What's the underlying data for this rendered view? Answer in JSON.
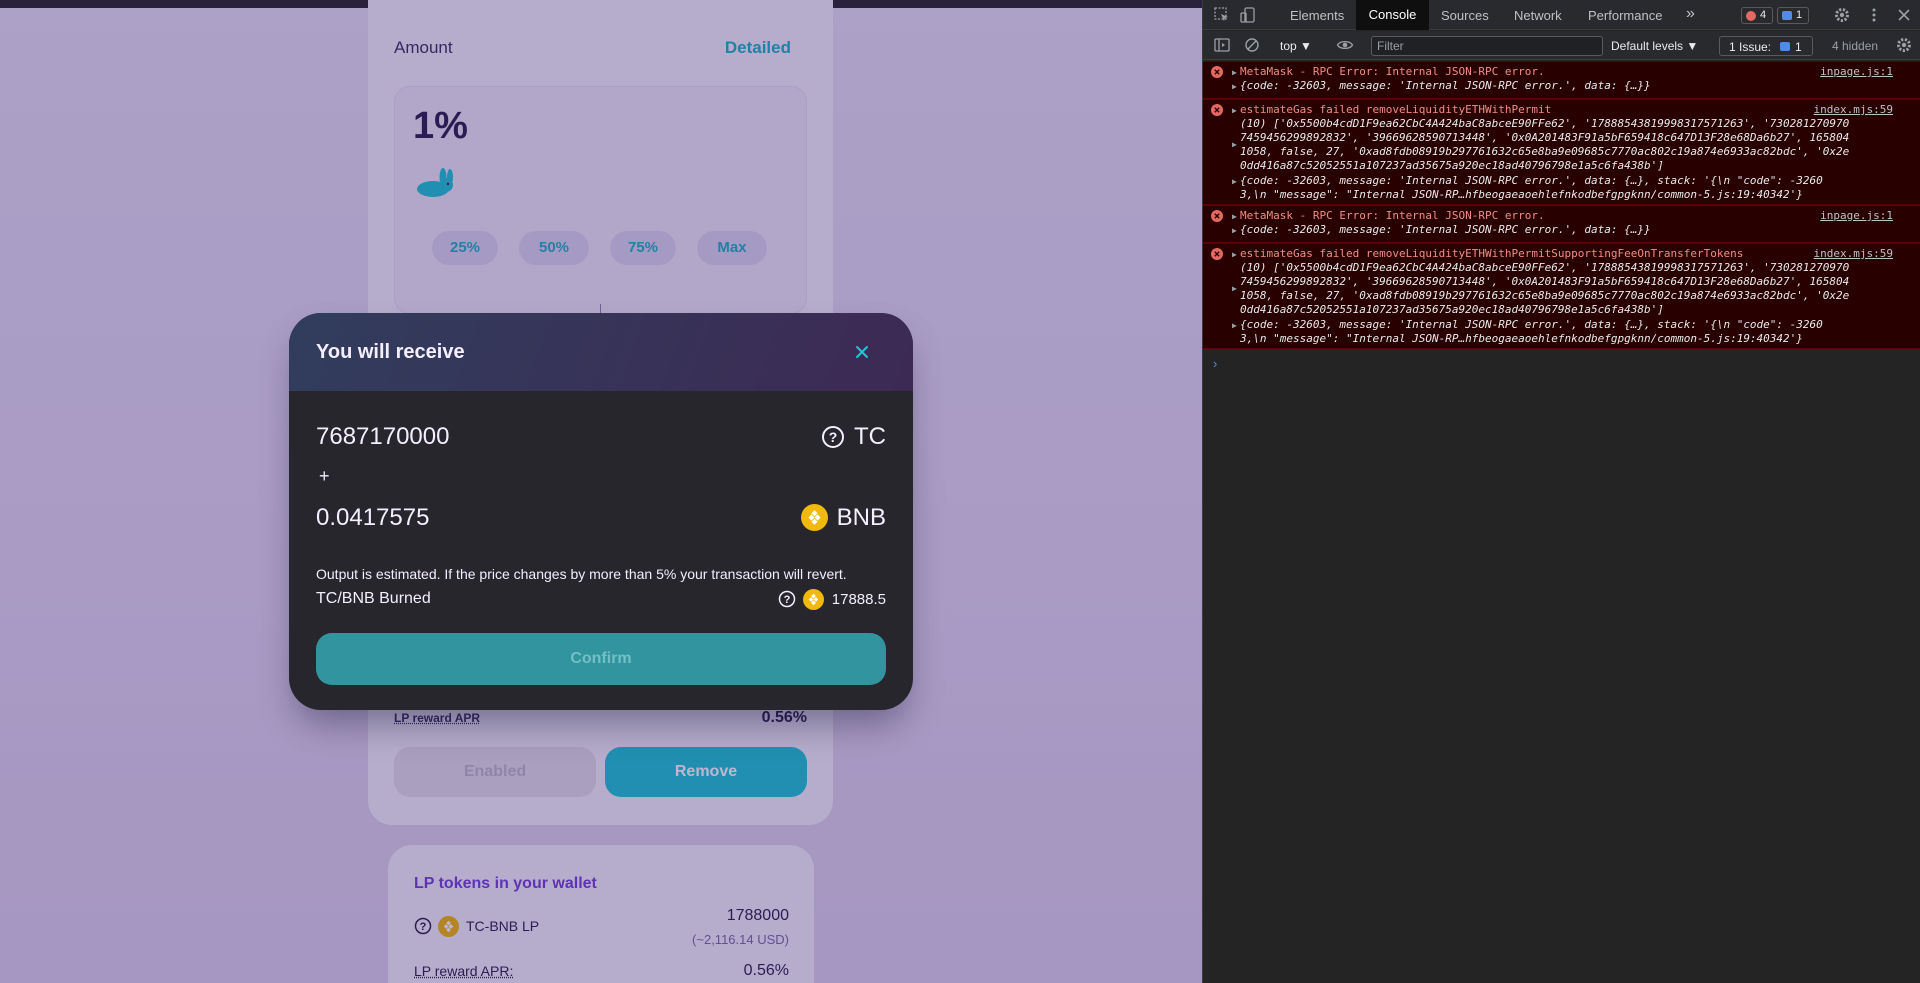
{
  "app": {
    "liquidity": {
      "amount_label": "Amount",
      "detailed_label": "Detailed",
      "percent_value": "1%",
      "percent_buttons": [
        "25%",
        "50%",
        "75%",
        "Max"
      ],
      "lp_reward_apr_label": "LP reward APR",
      "lp_reward_apr_value": "0.56%",
      "enabled_label": "Enabled",
      "remove_label": "Remove"
    },
    "wallet": {
      "title": "LP tokens in your wallet",
      "pair": "TC-BNB LP",
      "amount": "1788000",
      "usd": "(~2,116.14 USD)",
      "apr_label": "LP reward APR:",
      "apr_value": "0.56%"
    }
  },
  "modal": {
    "title": "You will receive",
    "close_icon": "close-icon",
    "token_a_amount": "7687170000",
    "token_a_symbol": "TC",
    "plus": "+",
    "token_b_amount": "0.0417575",
    "token_b_symbol": "BNB",
    "estimate_note": "Output is estimated. If the price changes by more than 5% your transaction will revert.",
    "burned_label": "TC/BNB Burned",
    "burned_value": "17888.5",
    "confirm_label": "Confirm"
  },
  "devtools": {
    "tabs": [
      "Elements",
      "Console",
      "Sources",
      "Network",
      "Performance"
    ],
    "more": "»",
    "error_count": "4",
    "message_count": "1",
    "context": "top ▼",
    "filter_placeholder": "Filter",
    "levels": "Default levels ▼",
    "issues": "1 Issue:",
    "issues_count": "1",
    "hidden": "4 hidden",
    "entries": [
      {
        "message": "MetaMask - RPC Error: Internal JSON-RPC error.",
        "source": "inpage.js:1",
        "details": [
          "{code: -32603, message: 'Internal JSON-RPC error.', data: {…}}"
        ]
      },
      {
        "message": "estimateGas failed removeLiquidityETHWithPermit",
        "source": "index.mjs:59",
        "details": [
          "(10) ['0x5500b4cdD1F9ea62CbC4A424baC8abceE90FFe62', '17888543819998317571263', '730281270970",
          "7459456299892832', '39669628590713448', '0x0A201483F91a5bF659418c647D13F28e68Da6b27', 165804",
          "1058, false, 27, '0xad8fdb08919b297761632c65e8ba9e09685c7770ac802c19a874e6933ac82bdc', '0x2e",
          "0dd416a87c52052551a107237ad35675a920ec18ad40796798e1a5c6fa438b']",
          "{code: -32603, message: 'Internal JSON-RPC error.', data: {…}, stack: '{\\n  \"code\": -3260",
          "3,\\n  \"message\": \"Internal JSON-RP…hfbeogaeaoehlefnkodbefgpgknn/common-5.js:19:40342'}"
        ]
      },
      {
        "message": "MetaMask - RPC Error: Internal JSON-RPC error.",
        "source": "inpage.js:1",
        "details": [
          "{code: -32603, message: 'Internal JSON-RPC error.', data: {…}}"
        ]
      },
      {
        "message": "estimateGas failed removeLiquidityETHWithPermitSupportingFeeOnTransferTokens",
        "source": "index.mjs:59",
        "details": [
          "(10) ['0x5500b4cdD1F9ea62CbC4A424baC8abceE90FFe62', '17888543819998317571263', '730281270970",
          "7459456299892832', '39669628590713448', '0x0A201483F91a5bF659418c647D13F28e68Da6b27', 165804",
          "1058, false, 27, '0xad8fdb08919b297761632c65e8ba9e09685c7770ac802c19a874e6933ac82bdc', '0x2e",
          "0dd416a87c52052551a107237ad35675a920ec18ad40796798e1a5c6fa438b']",
          "{code: -32603, message: 'Internal JSON-RPC error.', data: {…}, stack: '{\\n  \"code\": -3260",
          "3,\\n  \"message\": \"Internal JSON-RP…hfbeogaeaoehlefnkodbefgpgknn/common-5.js:19:40342'}"
        ]
      }
    ],
    "prompt": "›"
  },
  "colors": {
    "accent": "#1fc7d4",
    "modal_bg": "#27262c",
    "error_text": "#f28b82"
  }
}
